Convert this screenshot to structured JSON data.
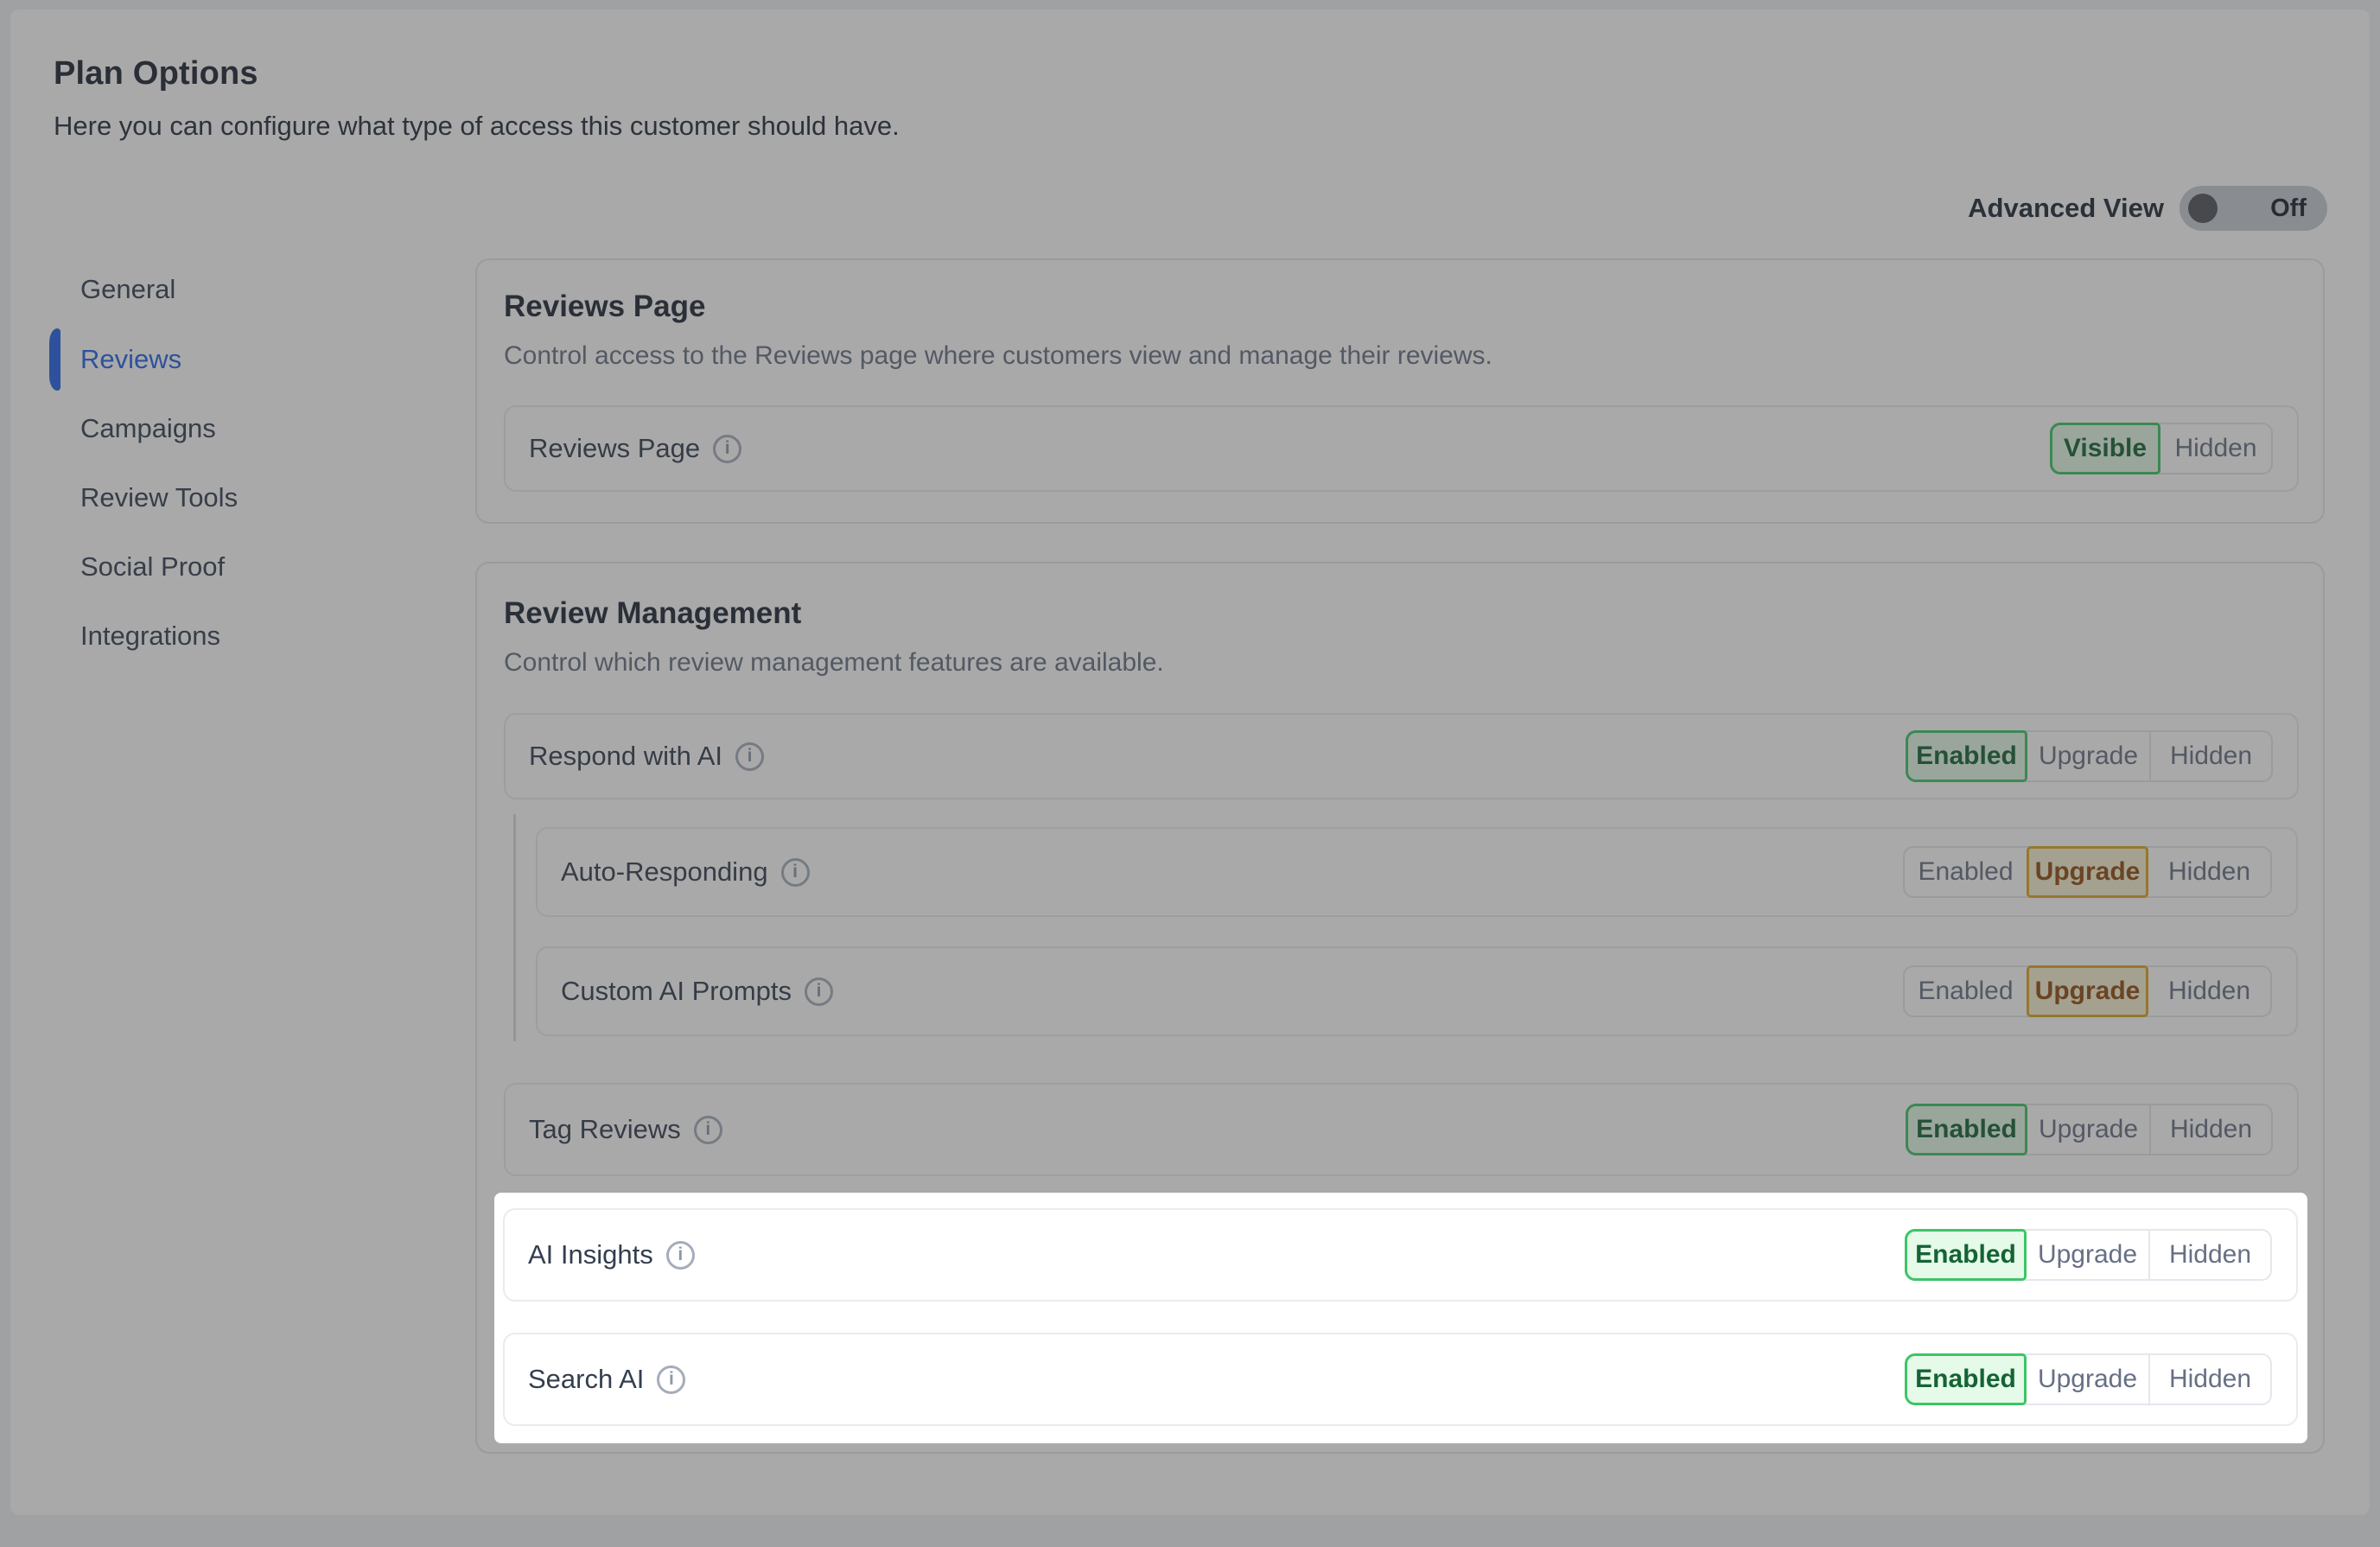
{
  "page": {
    "title": "Plan Options",
    "subtitle": "Here you can configure what type of access this customer should have."
  },
  "advanced": {
    "label": "Advanced View",
    "state": "Off",
    "enabled": false
  },
  "sidebar": {
    "items": [
      {
        "label": "General",
        "active": false
      },
      {
        "label": "Reviews",
        "active": true
      },
      {
        "label": "Campaigns",
        "active": false
      },
      {
        "label": "Review Tools",
        "active": false
      },
      {
        "label": "Social Proof",
        "active": false
      },
      {
        "label": "Integrations",
        "active": false
      }
    ]
  },
  "cards": [
    {
      "title": "Reviews Page",
      "subtitle": "Control access to the Reviews page where customers view and manage their reviews.",
      "rows": [
        {
          "label": "Reviews Page",
          "has_info_icon": true,
          "options": [
            "Visible",
            "Hidden"
          ],
          "selected": "Visible",
          "selected_style": "green"
        }
      ]
    },
    {
      "title": "Review Management",
      "subtitle": "Control which review management features are available.",
      "rows": [
        {
          "label": "Respond with AI",
          "has_info_icon": true,
          "options": [
            "Enabled",
            "Upgrade",
            "Hidden"
          ],
          "selected": "Enabled",
          "selected_style": "green",
          "indented": false,
          "spotlighted": false
        },
        {
          "label": "Auto-Responding",
          "has_info_icon": true,
          "options": [
            "Enabled",
            "Upgrade",
            "Hidden"
          ],
          "selected": "Upgrade",
          "selected_style": "amber",
          "indented": true,
          "spotlighted": false
        },
        {
          "label": "Custom AI Prompts",
          "has_info_icon": true,
          "options": [
            "Enabled",
            "Upgrade",
            "Hidden"
          ],
          "selected": "Upgrade",
          "selected_style": "amber",
          "indented": true,
          "spotlighted": false
        },
        {
          "label": "Tag Reviews",
          "has_info_icon": true,
          "options": [
            "Enabled",
            "Upgrade",
            "Hidden"
          ],
          "selected": "Enabled",
          "selected_style": "green",
          "indented": false,
          "spotlighted": false
        },
        {
          "label": "AI Insights",
          "has_info_icon": true,
          "options": [
            "Enabled",
            "Upgrade",
            "Hidden"
          ],
          "selected": "Enabled",
          "selected_style": "green",
          "indented": false,
          "spotlighted": true
        },
        {
          "label": "Search AI",
          "has_info_icon": true,
          "options": [
            "Enabled",
            "Upgrade",
            "Hidden"
          ],
          "selected": "Enabled",
          "selected_style": "green",
          "indented": false,
          "spotlighted": true
        }
      ]
    }
  ],
  "icons": {
    "info": "i"
  },
  "colors": {
    "accent_blue": "#2563eb",
    "enabled_green_border": "#3ec467",
    "enabled_green_bg": "#e5fae8",
    "enabled_green_text": "#156335",
    "upgrade_amber_border": "#dca625",
    "upgrade_amber_bg": "#f8f1d3",
    "upgrade_amber_text": "#8f4c10",
    "dim_overlay": "rgba(60,60,60,0.44)"
  }
}
